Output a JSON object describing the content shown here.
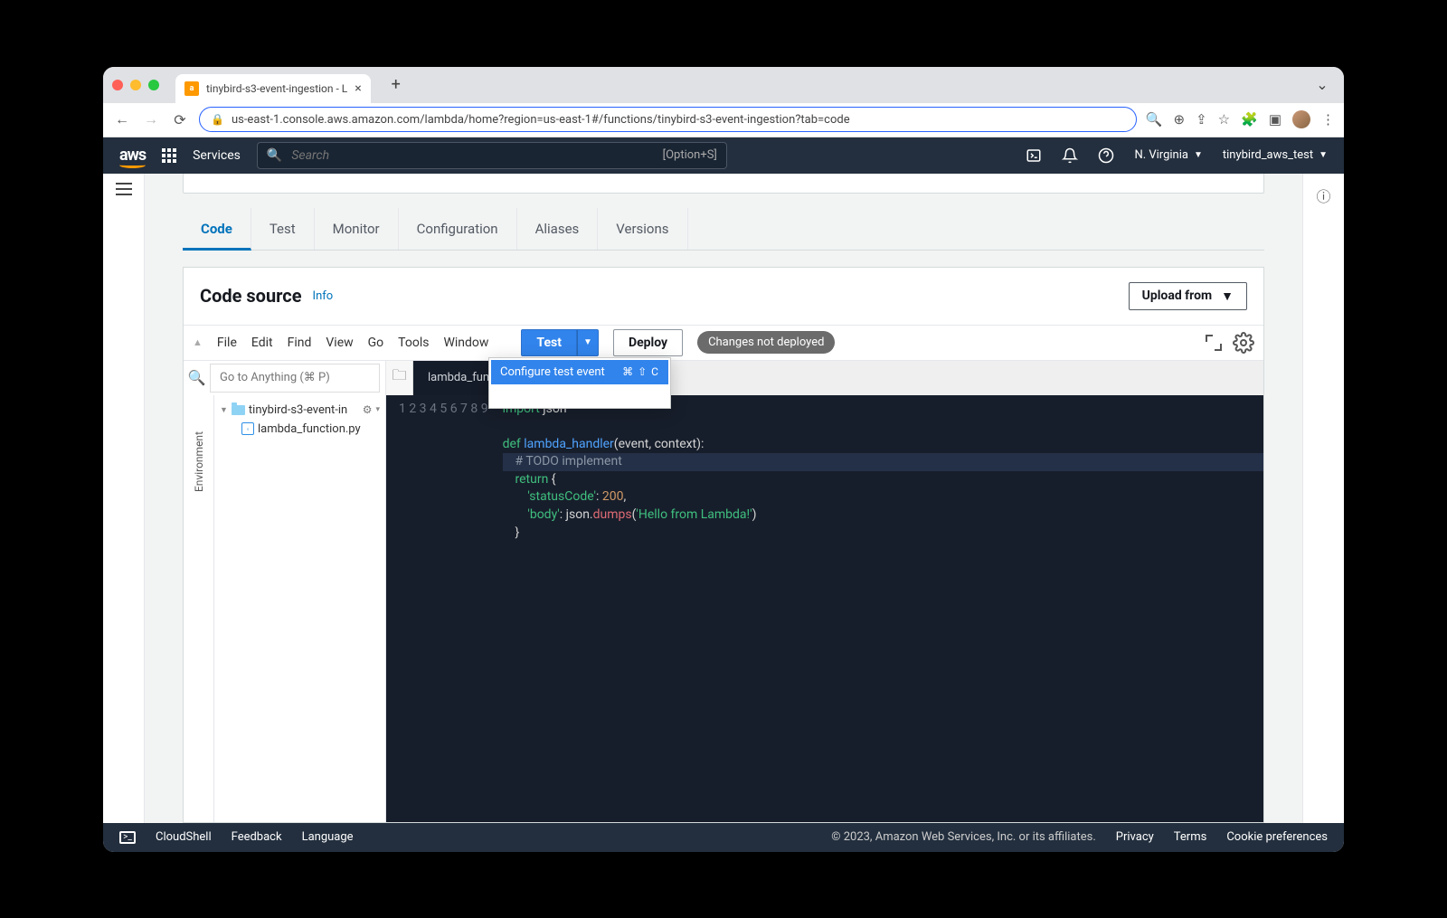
{
  "browser": {
    "tab_title": "tinybird-s3-event-ingestion - L",
    "url": "us-east-1.console.aws.amazon.com/lambda/home?region=us-east-1#/functions/tinybird-s3-event-ingestion?tab=code"
  },
  "aws_nav": {
    "services_label": "Services",
    "search_placeholder": "Search",
    "search_hint": "[Option+S]",
    "region": "N. Virginia",
    "account": "tinybird_aws_test"
  },
  "tabs": {
    "code": "Code",
    "test": "Test",
    "monitor": "Monitor",
    "configuration": "Configuration",
    "aliases": "Aliases",
    "versions": "Versions"
  },
  "code_source": {
    "heading": "Code source",
    "info_label": "Info",
    "upload_label": "Upload from"
  },
  "c9_menu": {
    "file": "File",
    "edit": "Edit",
    "find": "Find",
    "view": "View",
    "go": "Go",
    "tools": "Tools",
    "window": "Window"
  },
  "c9_toolbar": {
    "test_label": "Test",
    "deploy_label": "Deploy",
    "changes_pill": "Changes not deployed"
  },
  "test_dropdown": {
    "configure_label": "Configure test event",
    "shortcut": "⌘ ⇧ C"
  },
  "goto_placeholder": "Go to Anything (⌘ P)",
  "file_tab": "lambda_functi…",
  "env_label": "Environment",
  "tree": {
    "folder": "tinybird-s3-event-in",
    "file": "lambda_function.py"
  },
  "code_lines": {
    "1": "import json",
    "2": "",
    "3a": "def",
    "3b": " lambda_handler",
    "3c": "(event, context):",
    "4": "    # TODO implement",
    "5a": "    return",
    "5b": " {",
    "6a": "        'statusCode'",
    "6b": ": ",
    "6c": "200",
    "6d": ",",
    "7a": "        'body'",
    "7b": ": json.",
    "7c": "dumps",
    "7d": "(",
    "7e": "'Hello from Lambda!'",
    "7f": ")",
    "8": "    }",
    "9": ""
  },
  "footer": {
    "cloudshell": "CloudShell",
    "feedback": "Feedback",
    "language": "Language",
    "copyright": "© 2023, Amazon Web Services, Inc. or its affiliates.",
    "privacy": "Privacy",
    "terms": "Terms",
    "cookies": "Cookie preferences"
  }
}
